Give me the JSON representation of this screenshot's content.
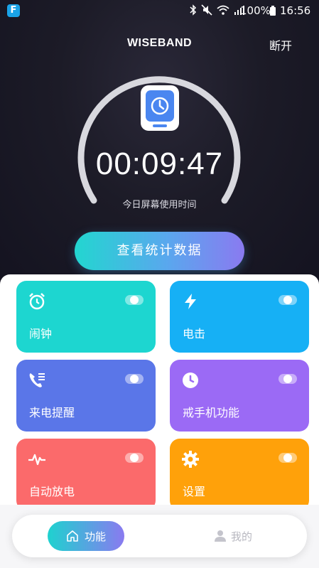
{
  "status_bar": {
    "app_badge": "F",
    "battery": "100%",
    "time": "16:56",
    "icons": [
      "bluetooth-icon",
      "mute-icon",
      "wifi-icon",
      "signal-icon",
      "battery-icon"
    ]
  },
  "header": {
    "title": "WISEBAND",
    "action": "断开"
  },
  "screen_time": {
    "value": "00:09:47",
    "label": "今日屏幕使用时间",
    "icon": "watch-icon"
  },
  "stats_button": {
    "label": "查看统计数据"
  },
  "features": [
    {
      "label": "闹钟",
      "icon": "alarm-clock-icon",
      "color": "#1dd6d0"
    },
    {
      "label": "电击",
      "icon": "lightning-icon",
      "color": "#16b0f5"
    },
    {
      "label": "来电提醒",
      "icon": "phone-list-icon",
      "color": "#5a76e8"
    },
    {
      "label": "戒手机功能",
      "icon": "clock-icon",
      "color": "#9b6af5"
    },
    {
      "label": "自动放电",
      "icon": "pulse-icon",
      "color": "#fb6a6b"
    },
    {
      "label": "设置",
      "icon": "gear-icon",
      "color": "#ffa10a"
    }
  ],
  "tabs": [
    {
      "label": "功能",
      "icon": "home-icon",
      "active": true
    },
    {
      "label": "我的",
      "icon": "person-icon",
      "active": false
    }
  ],
  "colors": {
    "background": "#16151f",
    "accent_start": "#22d6d0",
    "accent_end": "#8a7af0"
  }
}
